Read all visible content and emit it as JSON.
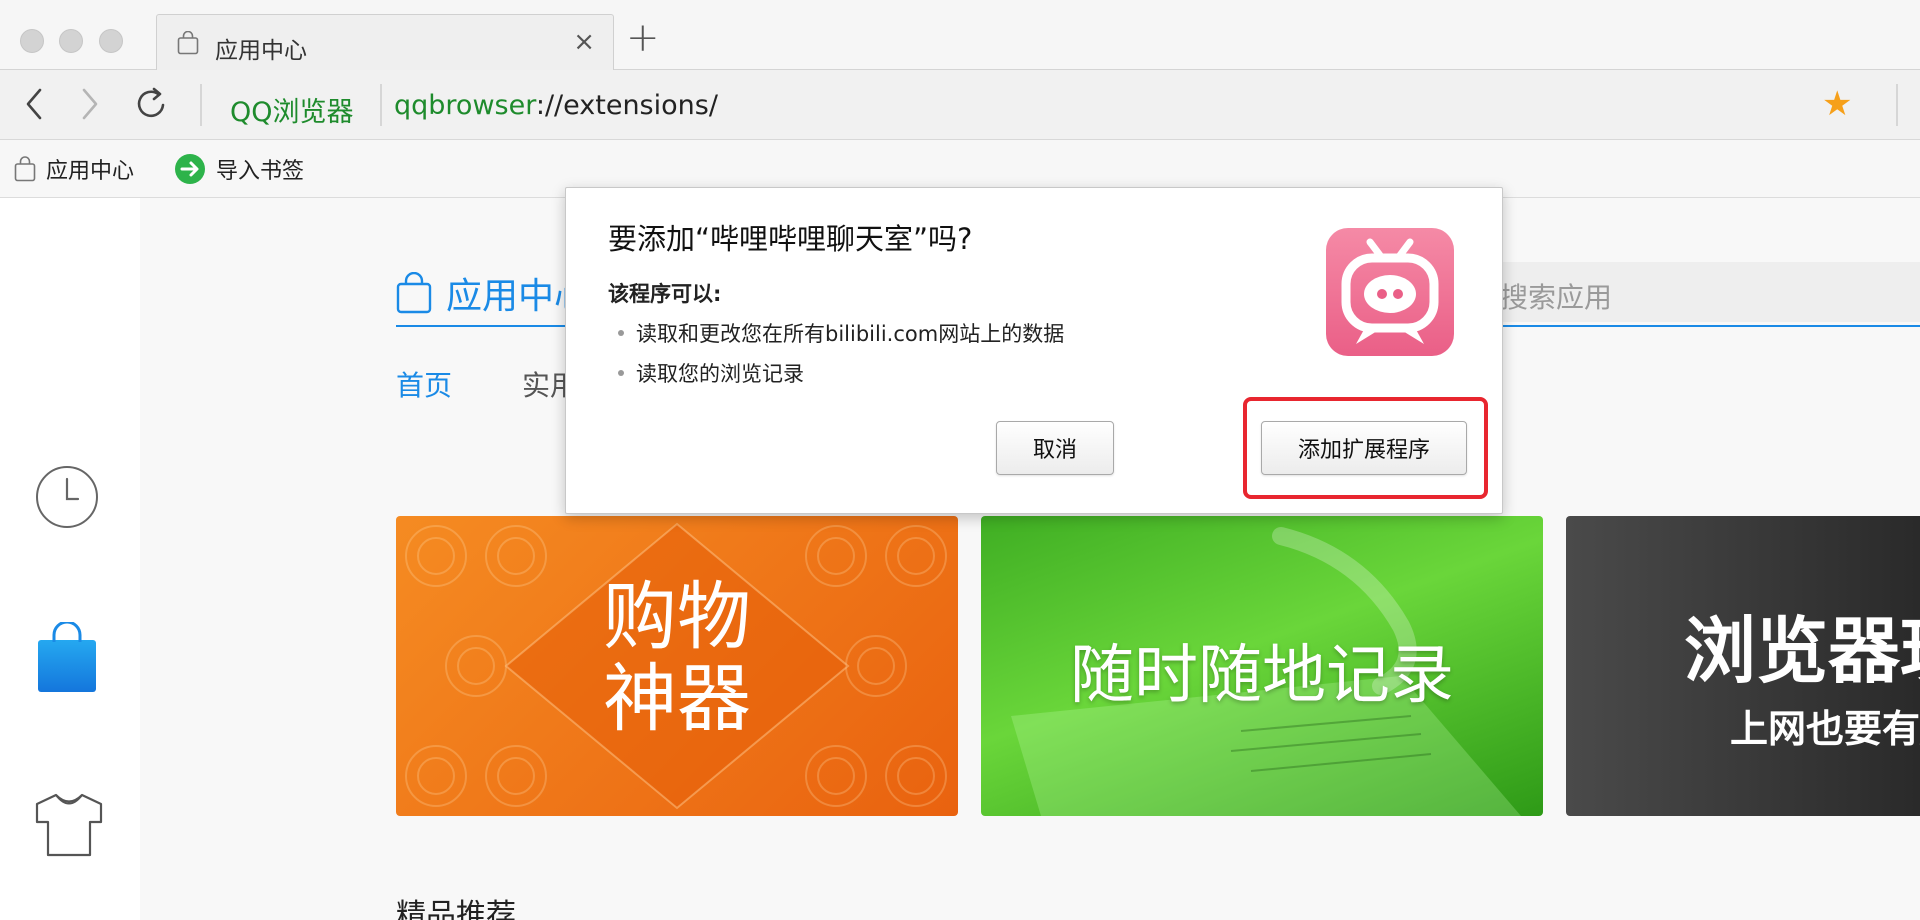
{
  "window": {
    "tab_title": "应用中心",
    "tab_close": "×",
    "new_tab": "+"
  },
  "address_bar": {
    "brand": "QQ浏览器",
    "url_scheme": "qqbrowser",
    "url_rest": "://extensions/",
    "star_icon": "star-icon",
    "star_color": "#f6a01a"
  },
  "bookmarks": [
    {
      "label": "应用中心",
      "icon": "bag-icon"
    },
    {
      "label": "导入书签",
      "icon": "import-arrow-icon"
    }
  ],
  "sidebar": {
    "items": [
      {
        "name": "history",
        "icon": "clock-icon"
      },
      {
        "name": "app-store",
        "icon": "shopping-bag-icon",
        "active": true
      },
      {
        "name": "skins",
        "icon": "tshirt-icon"
      }
    ]
  },
  "store": {
    "title": "应用中心",
    "search_placeholder": "搜索应用",
    "subnav": [
      {
        "label": "首页",
        "active": true
      },
      {
        "label": "实用"
      }
    ],
    "banners": [
      {
        "line1": "购物",
        "line2": "神器",
        "color": "#f07a1c"
      },
      {
        "line1": "随时随地记录",
        "color": "#52c32b"
      },
      {
        "line1": "浏览器玩",
        "line2": "上网也要有腔",
        "color": "#3a3a3a"
      }
    ],
    "section_title": "精品推荐",
    "accent_color": "#1a8ae6"
  },
  "dialog": {
    "title": "要添加“哔哩哔哩聊天室”吗?",
    "subtitle": "该程序可以:",
    "permissions": [
      "读取和更改您在所有bilibili.com网站上的数据",
      "读取您的浏览记录"
    ],
    "app_icon": "bilibili-tv-icon",
    "cancel_label": "取消",
    "confirm_label": "添加扩展程序",
    "highlight_color": "#e8262f"
  }
}
